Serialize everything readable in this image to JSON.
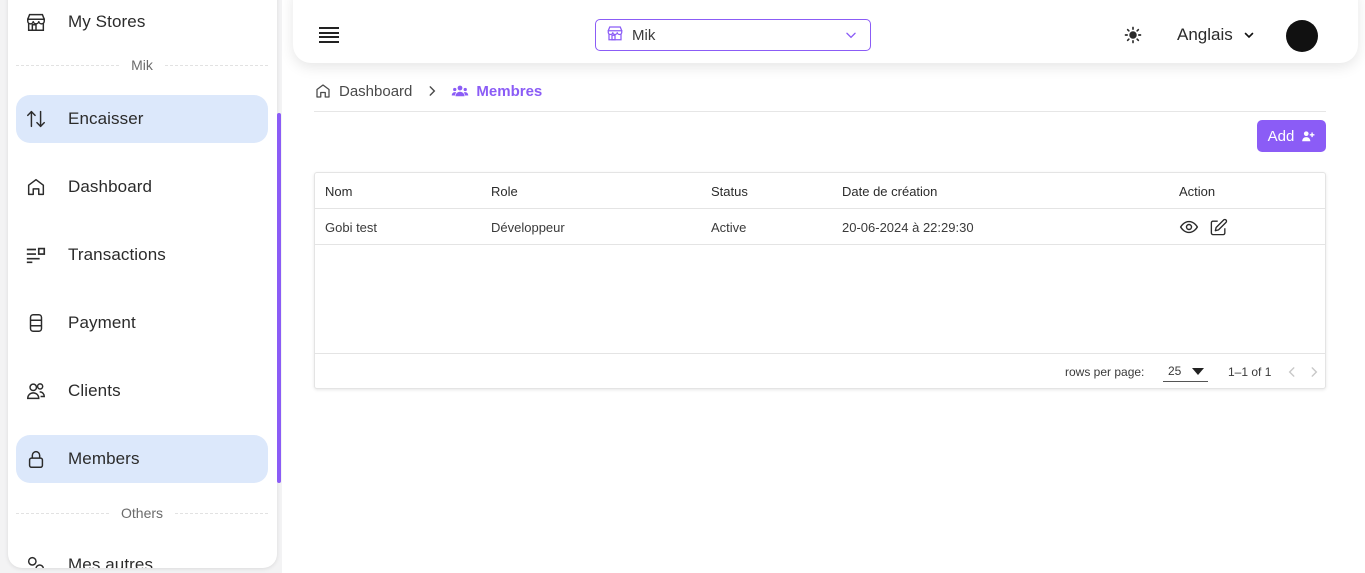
{
  "sidebar": {
    "items": [
      {
        "label": "My Stores",
        "icon": "store-icon"
      },
      {
        "label": "Encaisser",
        "icon": "swap-vertical-icon"
      },
      {
        "label": "Dashboard",
        "icon": "home-icon"
      },
      {
        "label": "Transactions",
        "icon": "transactions-icon"
      },
      {
        "label": "Payment",
        "icon": "payment-icon"
      },
      {
        "label": "Clients",
        "icon": "users-icon"
      },
      {
        "label": "Members",
        "icon": "lock-icon"
      },
      {
        "label": "Mes autres",
        "icon": "link-icon"
      }
    ],
    "sections": [
      "Mik",
      "Others"
    ]
  },
  "header": {
    "store": "Mik",
    "language": "Anglais"
  },
  "breadcrumb": {
    "home": "Dashboard",
    "current": "Membres"
  },
  "actions": {
    "add_label": "Add"
  },
  "table": {
    "columns": [
      "Nom",
      "Role",
      "Status",
      "Date de création",
      "Action"
    ],
    "rows": [
      {
        "nom": "Gobi test",
        "role": "Développeur",
        "status": "Active",
        "date": "20-06-2024 à 22:29:30"
      }
    ],
    "rows_per_page_label": "rows per page:",
    "rows_per_page": "25",
    "page_info": "1–1 of 1"
  },
  "colors": {
    "accent": "#8b5cf6",
    "active_item_bg": "#dce8fb"
  }
}
